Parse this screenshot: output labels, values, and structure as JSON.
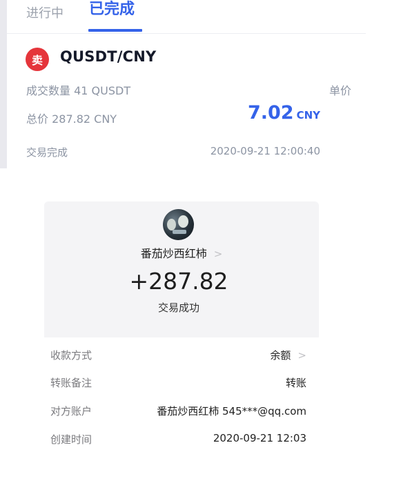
{
  "tabs": {
    "in_progress": "进行中",
    "completed": "已完成"
  },
  "order": {
    "side_badge": "卖",
    "pair": "QUSDT/CNY",
    "quantity": "成交数量 41 QUSDT",
    "unit_price_label": "单价",
    "total": "总价 287.82 CNY",
    "unit_price": "7.02",
    "unit_price_currency": "CNY",
    "status": "交易完成",
    "time": "2020-09-21 12:00:40"
  },
  "transfer": {
    "payer_name": "番茄炒西红柿",
    "payer_chevron": ">",
    "amount": "+287.82",
    "status": "交易成功",
    "details": [
      {
        "label": "收款方式",
        "value": "余额",
        "chevron": ">"
      },
      {
        "label": "转账备注",
        "value": "转账"
      },
      {
        "label": "对方账户",
        "value": "番茄炒西红柿 545***@qq.com"
      },
      {
        "label": "创建时间",
        "value": "2020-09-21 12:03"
      }
    ]
  },
  "colors": {
    "accent": "#3563e9",
    "sell_red": "#e5353b",
    "muted": "#8c94a3",
    "card_bg": "#f4f4f6"
  },
  "icons": {
    "avatar": "avatar-photo",
    "chevron": "chevron-right-icon"
  }
}
